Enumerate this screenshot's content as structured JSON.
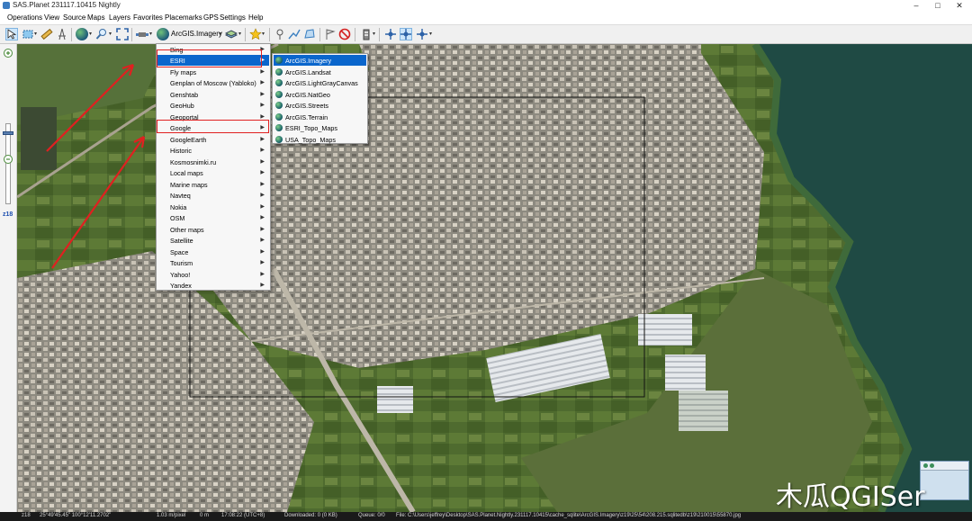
{
  "window": {
    "title": "SAS.Planet 231117.10415 Nightly",
    "controls": [
      "–",
      "□",
      "✕"
    ]
  },
  "menubar": [
    "Operations",
    "View",
    "Source",
    "Maps",
    "Layers",
    "Favorites",
    "Placemarks",
    "GPS",
    "Settings",
    "Help"
  ],
  "toolbar": {
    "current_source": "ArcGIS.Imagery"
  },
  "zoom": {
    "level_label": "z18"
  },
  "maps_menu": {
    "items": [
      {
        "label": "Bing",
        "has_submenu": true
      },
      {
        "label": "ESRI",
        "has_submenu": true,
        "highlighted": true
      },
      {
        "label": "Fly maps",
        "has_submenu": true
      },
      {
        "label": "Genplan of Moscow (Yabloko)",
        "has_submenu": true
      },
      {
        "label": "Genshtab",
        "has_submenu": true
      },
      {
        "label": "GeoHub",
        "has_submenu": true
      },
      {
        "label": "Geoportal",
        "has_submenu": true
      },
      {
        "label": "Google",
        "has_submenu": true
      },
      {
        "label": "GoogleEarth",
        "has_submenu": true
      },
      {
        "label": "Historic",
        "has_submenu": true
      },
      {
        "label": "Kosmosnimki.ru",
        "has_submenu": true
      },
      {
        "label": "Local maps",
        "has_submenu": true
      },
      {
        "label": "Marine maps",
        "has_submenu": true
      },
      {
        "label": "Navteq",
        "has_submenu": true
      },
      {
        "label": "Nokia",
        "has_submenu": true
      },
      {
        "label": "OSM",
        "has_submenu": true
      },
      {
        "label": "Other maps",
        "has_submenu": true
      },
      {
        "label": "Satellite",
        "has_submenu": true
      },
      {
        "label": "Space",
        "has_submenu": true
      },
      {
        "label": "Tourism",
        "has_submenu": true
      },
      {
        "label": "Yahoo!",
        "has_submenu": true
      },
      {
        "label": "Yandex",
        "has_submenu": true
      }
    ]
  },
  "esri_submenu": {
    "items": [
      {
        "label": "ArcGIS.Imagery",
        "highlighted": true
      },
      {
        "label": "ArcGIS.Landsat"
      },
      {
        "label": "ArcGIS.LightGrayCanvas"
      },
      {
        "label": "ArcGIS.NatGeo"
      },
      {
        "label": "ArcGIS.Streets"
      },
      {
        "label": "ArcGIS.Terrain"
      },
      {
        "label": "ESRI_Topo_Maps"
      },
      {
        "label": "USA_Topo_Maps"
      }
    ]
  },
  "statusbar": {
    "zoom": "z18",
    "coords": "25°49'45.45\"  100°12'11.2702\"",
    "scale": "1.03 m/pixel",
    "distance": "0 m",
    "time": "17:08:22 (UTC+8)",
    "downloaded": "Downloaded: 0 (0 KB)",
    "queue": "Queue: 0/0",
    "file": "File: C:\\Users\\jeffrey\\Desktop\\SAS.Planet.Nightly.231117.10415\\cache_sqlite\\ArcGIS.Imagery\\z19\\25\\54\\208.215.sqlitedb\\z19\\210015\\55870.jpg"
  },
  "watermark": "木瓜QGISer",
  "colors": {
    "menu_highlight": "#0a66cc",
    "annotation_red": "#e02020",
    "water": "#1f4a44"
  }
}
